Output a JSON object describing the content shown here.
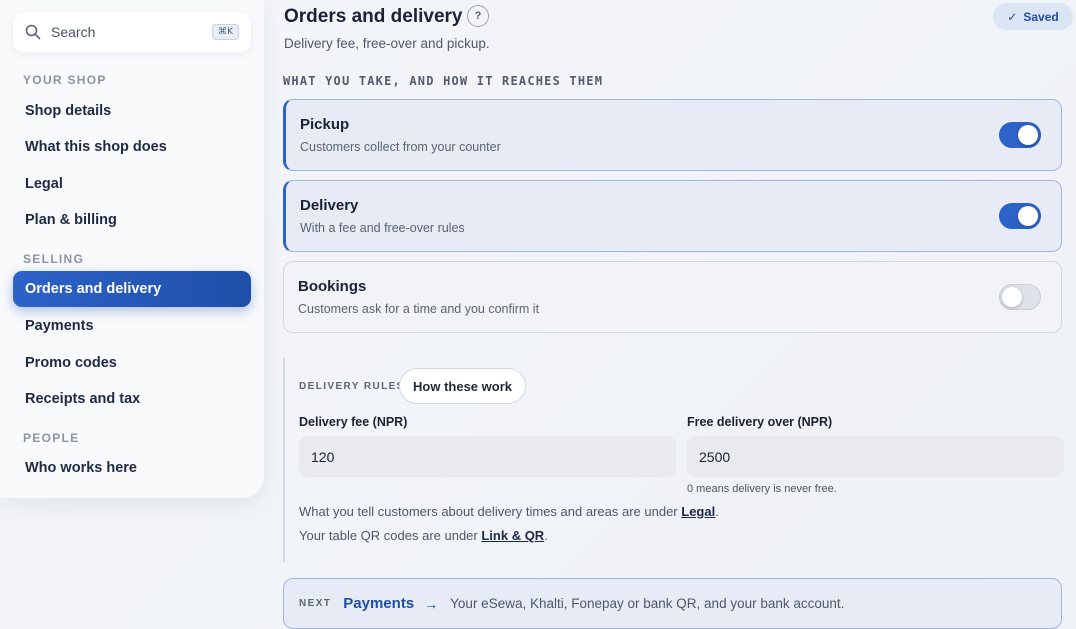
{
  "sidebar": {
    "search": {
      "label": "Search",
      "shortcut": "⌘K"
    },
    "sections": [
      {
        "label": "YOUR SHOP",
        "items": [
          "Shop details",
          "What this shop does",
          "Legal",
          "Plan & billing"
        ]
      },
      {
        "label": "SELLING",
        "items": [
          "Orders and delivery",
          "Payments",
          "Promo codes",
          "Receipts and tax"
        ]
      },
      {
        "label": "PEOPLE",
        "items": [
          "Who works here"
        ]
      }
    ],
    "active_item": "Orders and delivery"
  },
  "header": {
    "title": "Orders and delivery",
    "help": "?",
    "subtitle": "Delivery fee, free-over and pickup.",
    "saved": {
      "icon": "check-icon",
      "label": "Saved"
    }
  },
  "options": {
    "group_label": "WHAT YOU TAKE, AND HOW IT REACHES THEM",
    "items": [
      {
        "title": "Pickup",
        "desc": "Customers collect from your counter",
        "enabled": true
      },
      {
        "title": "Delivery",
        "desc": "With a fee and free-over rules",
        "enabled": true
      },
      {
        "title": "Bookings",
        "desc": "Customers ask for a time and you confirm it",
        "enabled": false
      }
    ]
  },
  "delivery_rules": {
    "label": "DELIVERY RULES",
    "how_button": "How these work",
    "fee": {
      "label": "Delivery fee (NPR)",
      "value": "120"
    },
    "free_over": {
      "label": "Free delivery over (NPR)",
      "value": "2500",
      "hint": "0 means delivery is never free."
    },
    "note1": {
      "text": "What you tell customers about delivery times and areas are under ",
      "link": "Legal",
      "suffix": "."
    },
    "note2": {
      "text": "Your table QR codes are under ",
      "link": "Link & QR",
      "suffix": "."
    }
  },
  "next": {
    "tag": "NEXT",
    "link": "Payments",
    "arrow": "→",
    "desc": "Your eSewa, Khalti, Fonepay or bank QR, and your bank account."
  },
  "colors": {
    "accent": "#2d62c8",
    "accent_dark": "#1e4fa8"
  }
}
